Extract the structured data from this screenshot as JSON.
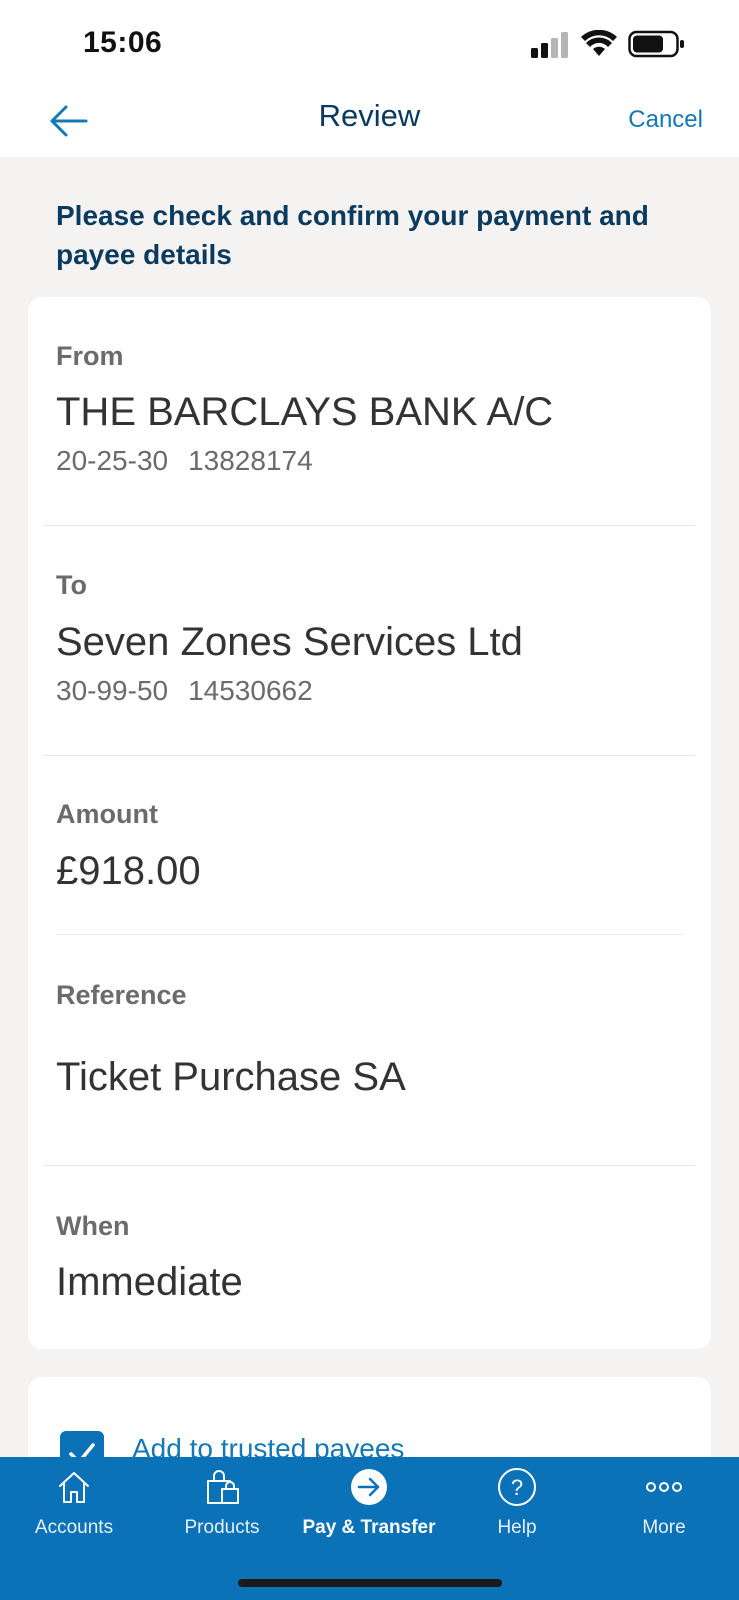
{
  "status_bar": {
    "time": "15:06"
  },
  "nav": {
    "title": "Review",
    "cancel_label": "Cancel"
  },
  "instruction": "Please check and confirm your payment and payee details",
  "details": {
    "from": {
      "label": "From",
      "name": "THE BARCLAYS BANK A/C",
      "sort_code": "20-25-30",
      "account_number": "13828174"
    },
    "to": {
      "label": "To",
      "name": "Seven Zones Services Ltd",
      "sort_code": "30-99-50",
      "account_number": "14530662"
    },
    "amount": {
      "label": "Amount",
      "value": "£918.00"
    },
    "reference": {
      "label": "Reference",
      "value": "Ticket Purchase SA"
    },
    "when": {
      "label": "When",
      "value": "Immediate"
    }
  },
  "trusted": {
    "label": "Add to trusted payees",
    "checked": true
  },
  "tabs": [
    {
      "label": "Accounts",
      "icon": "home-icon"
    },
    {
      "label": "Products",
      "icon": "shopping-bag-icon"
    },
    {
      "label": "Pay & Transfer",
      "icon": "arrow-right-circle-icon",
      "active": true
    },
    {
      "label": "Help",
      "icon": "question-circle-icon"
    },
    {
      "label": "More",
      "icon": "more-dots-icon"
    }
  ],
  "colors": {
    "brand": "#0b72b8",
    "link": "#1478b7",
    "heading": "#0b3a5f"
  }
}
